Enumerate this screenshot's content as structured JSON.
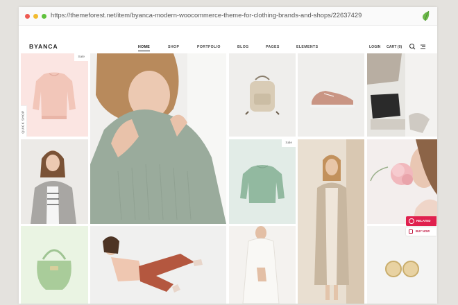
{
  "browser": {
    "url": "https://themeforest.net/item/byanca-modern-woocommerce-theme-for-clothing-brands-and-shops/22637429",
    "extension_icon": "leaf-icon"
  },
  "site": {
    "logo": "BYANCA",
    "menu": [
      "HOME",
      "SHOP",
      "PORTFOLIO",
      "BLOG",
      "PAGES",
      "ELEMENTS"
    ],
    "active_menu": "HOME",
    "login": "LOGIN",
    "cart": "CART (0)"
  },
  "grid": {
    "badge_1": "Sale",
    "badge_2": "Sale",
    "quick_shop": "QUICK SHOP"
  },
  "widgets": {
    "related": "RELATED",
    "buy_now": "BUY NOW"
  },
  "colors": {
    "accent": "#e0204e",
    "sweater_green": "#9aab9c",
    "blush": "#f6dcd4"
  }
}
